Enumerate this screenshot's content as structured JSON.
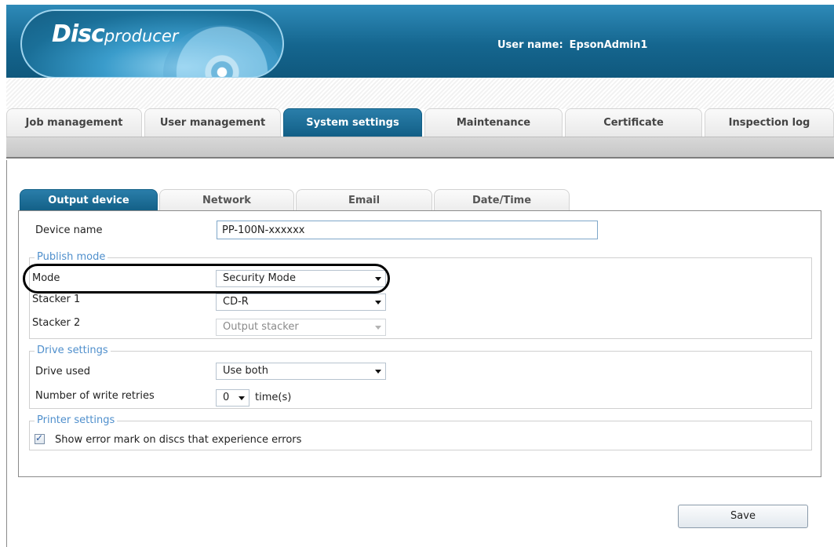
{
  "header": {
    "logo_main": "Disc",
    "logo_sub": "producer",
    "user_label": "User name:",
    "user_name": "EpsonAdmin1"
  },
  "main_tabs": [
    {
      "label": "Job management",
      "active": false
    },
    {
      "label": "User management",
      "active": false
    },
    {
      "label": "System settings",
      "active": true
    },
    {
      "label": "Maintenance",
      "active": false
    },
    {
      "label": "Certificate",
      "active": false
    },
    {
      "label": "Inspection log",
      "active": false
    }
  ],
  "sub_tabs": [
    {
      "label": "Output device",
      "active": true
    },
    {
      "label": "Network",
      "active": false
    },
    {
      "label": "Email",
      "active": false
    },
    {
      "label": "Date/Time",
      "active": false
    }
  ],
  "form": {
    "device_name_label": "Device name",
    "device_name_value": "PP-100N-xxxxxx",
    "publish_mode_legend": "Publish mode",
    "mode_label": "Mode",
    "mode_value": "Security Mode",
    "stacker1_label": "Stacker 1",
    "stacker1_value": "CD-R",
    "stacker2_label": "Stacker 2",
    "stacker2_value": "Output stacker",
    "drive_settings_legend": "Drive settings",
    "drive_used_label": "Drive used",
    "drive_used_value": "Use both",
    "write_retries_label": "Number of write retries",
    "write_retries_value": "0",
    "write_retries_unit": "time(s)",
    "printer_settings_legend": "Printer settings",
    "error_mark_label": "Show error mark on discs that experience errors",
    "error_mark_checked": true
  },
  "actions": {
    "save_label": "Save"
  },
  "colors": {
    "header_blue": "#15668f",
    "active_tab": "#125f86",
    "legend_blue": "#4f8fcc"
  }
}
